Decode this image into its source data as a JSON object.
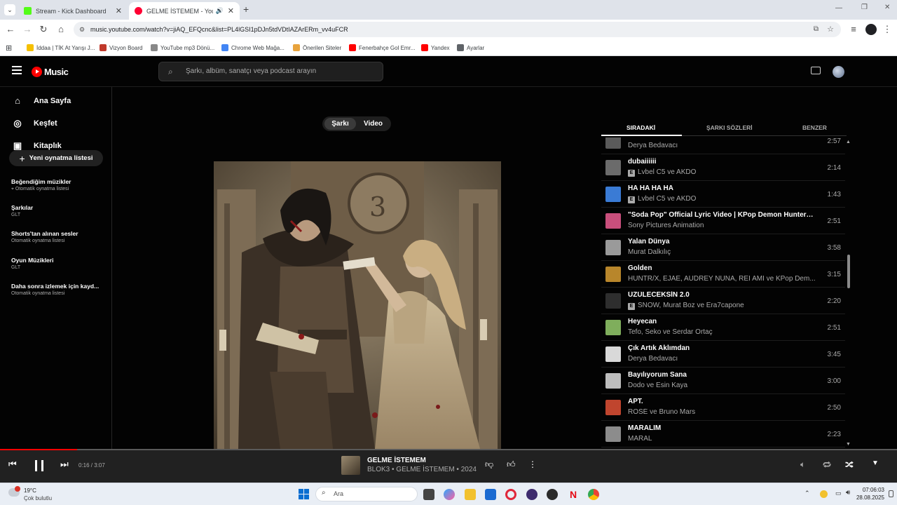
{
  "browser": {
    "tabs": [
      {
        "title": "Stream - Kick Dashboard",
        "active": false,
        "color": "#53fc18"
      },
      {
        "title": "GELME İSTEMEM - YouTube",
        "active": true,
        "color": "#ff0033"
      }
    ],
    "new_tab": "+",
    "url": "music.youtube.com/watch?v=jiAQ_EFQcnc&list=PL4lGSI1pDJn5tdVDtIAZArERm_vv4uFCR",
    "bookmarks": [
      {
        "label": "İddaa | TİK At Yarışı J...",
        "color": "#f5c000"
      },
      {
        "label": "Vizyon Board",
        "color": "#c0392b"
      },
      {
        "label": "YouTube mp3 Dönü...",
        "color": "#888888"
      },
      {
        "label": "Chrome Web Mağa...",
        "color": "#4285f4"
      },
      {
        "label": "Önerilen Siteler",
        "color": "#e8a33d"
      },
      {
        "label": "Fenerbahçe Gol Emr...",
        "color": "#ff0000"
      },
      {
        "label": "Yandex",
        "color": "#ff0000"
      },
      {
        "label": "Ayarlar",
        "color": "#5f6368"
      }
    ]
  },
  "app": {
    "logo": "Music",
    "search_placeholder": "Şarkı, albüm, sanatçı veya podcast arayın",
    "nav": [
      {
        "label": "Ana Sayfa",
        "icon": "home-icon"
      },
      {
        "label": "Keşfet",
        "icon": "explore-icon"
      },
      {
        "label": "Kitaplık",
        "icon": "library-icon"
      }
    ],
    "new_playlist": "Yeni oynatma listesi",
    "playlists": [
      {
        "title": "Beğendiğim müzikler",
        "sub": "Otomatik oynatma listesi",
        "pinned": true
      },
      {
        "title": "Şarkılar",
        "sub": "GLT"
      },
      {
        "title": "Shorts'tan alınan sesler",
        "sub": "Otomatik oynatma listesi"
      },
      {
        "title": "Oyun Müzikleri",
        "sub": "GLT"
      },
      {
        "title": "Daha sonra izlemek için kayd...",
        "sub": "Otomatik oynatma listesi"
      }
    ],
    "toggle": {
      "song": "Şarkı",
      "video": "Video"
    },
    "queue_tabs": [
      "SIRADAKİ",
      "ŞARKI SÖZLERİ",
      "BENZER"
    ],
    "queue": [
      {
        "title": "",
        "artist": "Derya Bedavacı",
        "duration": "2:57",
        "explicit": false,
        "thumb": "#5a5a5a"
      },
      {
        "title": "dubaiiiiii",
        "artist": "Lvbel C5 ve AKDO",
        "duration": "2:14",
        "explicit": true,
        "thumb": "#6b6b6b"
      },
      {
        "title": "HA HA HA HA",
        "artist": "Lvbel C5 ve AKDO",
        "duration": "1:43",
        "explicit": true,
        "thumb": "#3a7bd5"
      },
      {
        "title": "\"Soda Pop\" Official Lyric Video | KPop Demon Hunters ...",
        "artist": "Sony Pictures Animation",
        "duration": "2:51",
        "explicit": false,
        "thumb": "#c94f7c"
      },
      {
        "title": "Yalan Dünya",
        "artist": "Murat Dalkılıç",
        "duration": "3:58",
        "explicit": false,
        "thumb": "#9a9a9a"
      },
      {
        "title": "Golden",
        "artist": "HUNTR/X, EJAE, AUDREY NUNA, REI AMI ve KPop Dem...",
        "duration": "3:15",
        "explicit": false,
        "thumb": "#b8862b"
      },
      {
        "title": "ÜZÜLECEKSİN 2.0",
        "artist": "SNOW, Murat Boz ve Era7capone",
        "duration": "2:20",
        "explicit": true,
        "thumb": "#2e2e2e"
      },
      {
        "title": "Heyecan",
        "artist": "Tefo, Seko ve Serdar Ortaç",
        "duration": "2:51",
        "explicit": false,
        "thumb": "#7fae5c"
      },
      {
        "title": "Çık Artık Aklımdan",
        "artist": "Derya Bedavacı",
        "duration": "3:45",
        "explicit": false,
        "thumb": "#d9d9d9"
      },
      {
        "title": "Bayılıyorum Sana",
        "artist": "Dodo ve Esin Kaya",
        "duration": "3:00",
        "explicit": false,
        "thumb": "#bdbdbd"
      },
      {
        "title": "APT.",
        "artist": "ROSÉ ve Bruno Mars",
        "duration": "2:50",
        "explicit": false,
        "thumb": "#c0452e"
      },
      {
        "title": "MARALIM",
        "artist": "MARAL",
        "duration": "2:23",
        "explicit": false,
        "thumb": "#8c8c8c"
      }
    ],
    "player": {
      "time": "0:16 / 3:07",
      "progress": 0.0856,
      "title": "GELME İSTEMEM",
      "subtitle": "BLOK3 • GELME İSTEMEM • 2024"
    }
  },
  "taskbar": {
    "weather_temp": "19°C",
    "weather_text": "Çok bulutlu",
    "search_label": "Ara",
    "time": "07:06:03",
    "date": "28.08.2025"
  }
}
